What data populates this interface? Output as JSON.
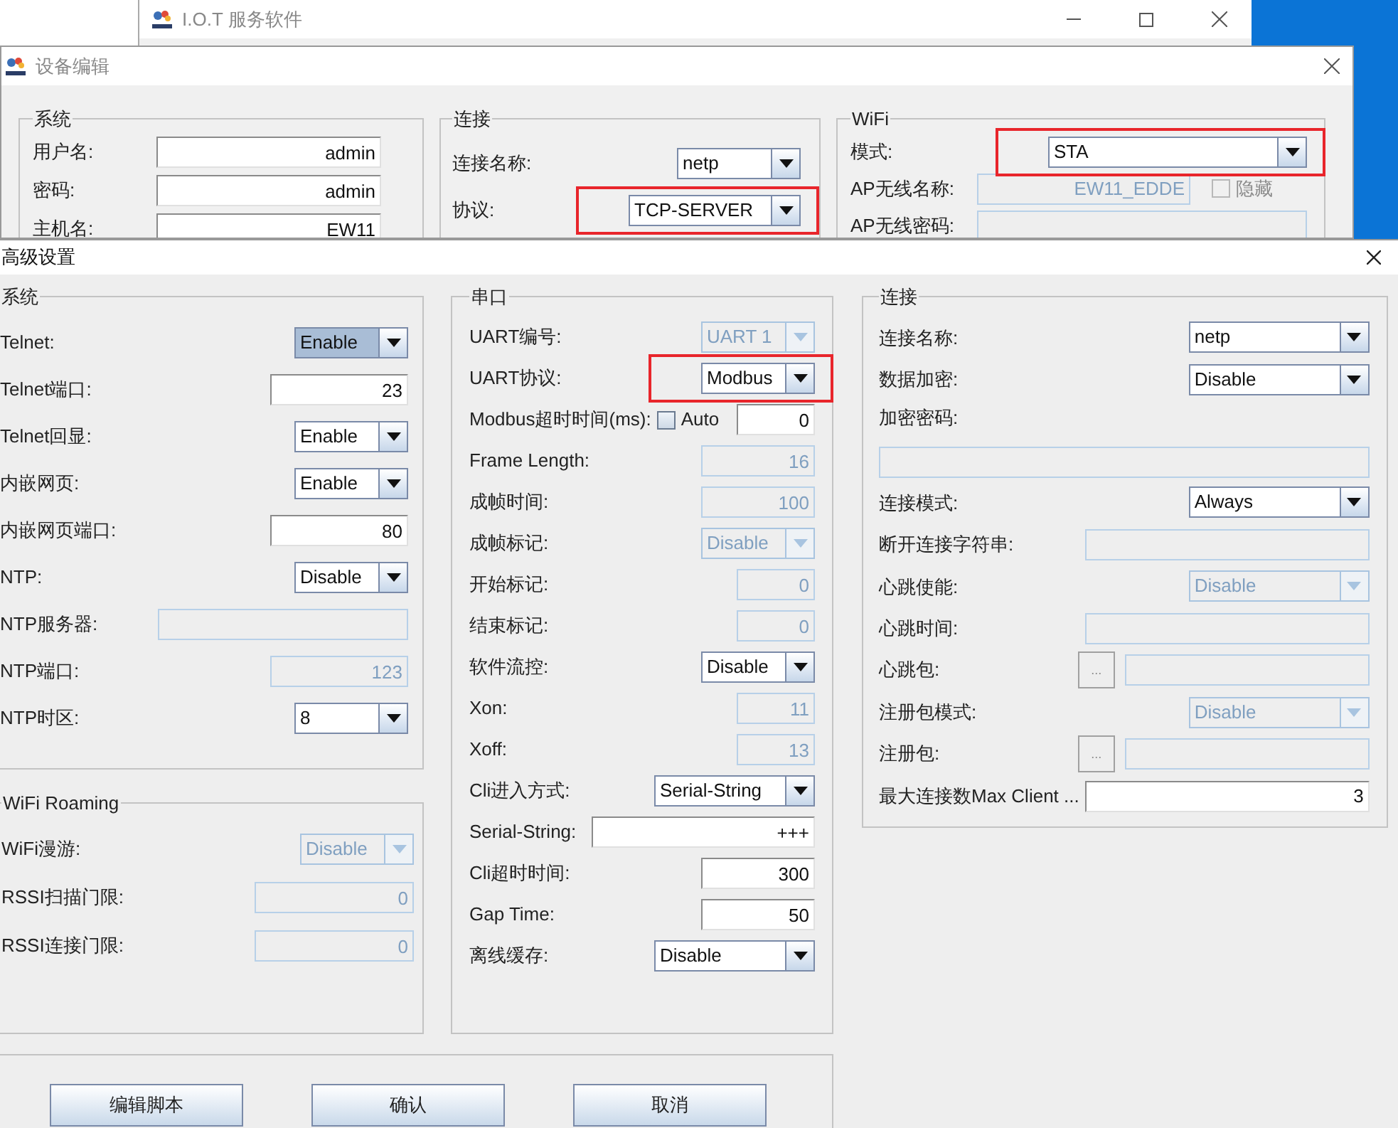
{
  "desktop_window": {
    "title": "I.O.T 服务软件"
  },
  "device_edit": {
    "title": "设备编辑",
    "groups": [
      {
        "title": "系统",
        "rows": [
          {
            "label": "用户名:",
            "kind": "field",
            "value": "admin",
            "disabled": false
          },
          {
            "label": "密码:",
            "kind": "field",
            "value": "admin",
            "disabled": false
          },
          {
            "label": "主机名:",
            "kind": "field",
            "value": "EW11",
            "disabled": false
          }
        ]
      },
      {
        "title": "连接",
        "rows": [
          {
            "label": "连接名称:",
            "kind": "combo",
            "value": "netp",
            "disabled": false,
            "highlighted": false,
            "focused": false
          },
          {
            "label": "协议:",
            "kind": "combo",
            "value": "TCP-SERVER",
            "disabled": false,
            "highlighted": true,
            "focused": false
          }
        ]
      },
      {
        "title": "WiFi",
        "rows": [
          {
            "label": "模式:",
            "kind": "combo",
            "value": "STA",
            "disabled": false,
            "highlighted": true,
            "focused": false
          },
          {
            "label": "AP无线名称:",
            "kind": "check_after",
            "value": "EW11_EDDE",
            "disabled": true,
            "check": {
              "label": "隐藏",
              "checked": false,
              "disabled": true
            }
          },
          {
            "label": "AP无线密码:",
            "kind": "field",
            "disabled": true
          }
        ]
      }
    ]
  },
  "advanced": {
    "title": "高级设置",
    "groups": [
      {
        "title": "系统",
        "rows": [
          {
            "label": "Telnet:",
            "kind": "combo",
            "value": "Enable",
            "disabled": false,
            "highlighted": false,
            "focused": true
          },
          {
            "label": "Telnet端口:",
            "kind": "field",
            "value": "23",
            "disabled": false
          },
          {
            "label": "Telnet回显:",
            "kind": "combo",
            "value": "Enable",
            "disabled": false,
            "highlighted": false,
            "focused": false
          },
          {
            "label": "内嵌网页:",
            "kind": "combo",
            "value": "Enable",
            "disabled": false,
            "highlighted": false,
            "focused": false
          },
          {
            "label": "内嵌网页端口:",
            "kind": "field",
            "value": "80",
            "disabled": false
          },
          {
            "label": "NTP:",
            "kind": "combo",
            "value": "Disable",
            "disabled": false,
            "highlighted": false,
            "focused": false
          },
          {
            "label": "NTP服务器:",
            "kind": "field",
            "disabled": true
          },
          {
            "label": "NTP端口:",
            "kind": "field",
            "value": "123",
            "disabled": true
          },
          {
            "label": "NTP时区:",
            "kind": "combo",
            "value": "8",
            "disabled": false,
            "highlighted": false,
            "focused": false
          }
        ]
      },
      {
        "title": "WiFi Roaming",
        "rows": [
          {
            "label": "WiFi漫游:",
            "kind": "combo",
            "value": "Disable",
            "disabled": true,
            "highlighted": false,
            "focused": false
          },
          {
            "label": "RSSI扫描门限:",
            "kind": "field",
            "value": "0",
            "disabled": true
          },
          {
            "label": "RSSI连接门限:",
            "kind": "field",
            "value": "0",
            "disabled": true
          }
        ]
      },
      {
        "title": "串口",
        "rows": [
          {
            "label": "UART编号:",
            "kind": "combo",
            "value": "UART 1",
            "disabled": true,
            "highlighted": false,
            "focused": false
          },
          {
            "label": "UART协议:",
            "kind": "combo",
            "value": "Modbus",
            "disabled": false,
            "highlighted": true,
            "focused": false
          },
          {
            "label": "Modbus超时时间(ms):",
            "kind": "check_before",
            "value": "0",
            "disabled": false,
            "check": {
              "label": "Auto",
              "checked": false,
              "disabled": false
            }
          },
          {
            "label": "Frame Length:",
            "kind": "field",
            "value": "16",
            "disabled": true
          },
          {
            "label": "成帧时间:",
            "kind": "field",
            "value": "100",
            "disabled": true
          },
          {
            "label": "成帧标记:",
            "kind": "combo",
            "value": "Disable",
            "disabled": true,
            "highlighted": false,
            "focused": false
          },
          {
            "label": "开始标记:",
            "kind": "field",
            "value": "0",
            "disabled": true
          },
          {
            "label": "结束标记:",
            "kind": "field",
            "value": "0",
            "disabled": true
          },
          {
            "label": "软件流控:",
            "kind": "combo",
            "value": "Disable",
            "disabled": false,
            "highlighted": false,
            "focused": false
          },
          {
            "label": "Xon:",
            "kind": "field",
            "value": "11",
            "disabled": true
          },
          {
            "label": "Xoff:",
            "kind": "field",
            "value": "13",
            "disabled": true
          },
          {
            "label": "Cli进入方式:",
            "kind": "combo",
            "value": "Serial-String",
            "disabled": false,
            "highlighted": false,
            "focused": false
          },
          {
            "label": "Serial-String:",
            "kind": "field",
            "value": "+++",
            "disabled": false
          },
          {
            "label": "Cli超时时间:",
            "kind": "field",
            "value": "300",
            "disabled": false
          },
          {
            "label": "Gap Time:",
            "kind": "field",
            "value": "50",
            "disabled": false
          },
          {
            "label": "离线缓存:",
            "kind": "combo",
            "value": "Disable",
            "disabled": false,
            "highlighted": false,
            "focused": false
          }
        ]
      },
      {
        "title": "连接",
        "rows": [
          {
            "label": "连接名称:",
            "kind": "combo",
            "value": "netp",
            "disabled": false,
            "highlighted": false,
            "focused": false
          },
          {
            "label": "数据加密:",
            "kind": "combo",
            "value": "Disable",
            "disabled": false,
            "highlighted": false,
            "focused": false
          },
          {
            "label": "加密密码:",
            "kind": "field_below",
            "disabled": true
          },
          {
            "label": "连接模式:",
            "kind": "combo",
            "value": "Always",
            "disabled": false,
            "highlighted": false,
            "focused": false
          },
          {
            "label": "断开连接字符串:",
            "kind": "field",
            "disabled": true
          },
          {
            "label": "心跳使能:",
            "kind": "combo",
            "value": "Disable",
            "disabled": true,
            "highlighted": false,
            "focused": false
          },
          {
            "label": "心跳时间:",
            "kind": "field",
            "disabled": true
          },
          {
            "label": "心跳包:",
            "kind": "button_field",
            "button": "...",
            "disabled": true
          },
          {
            "label": "注册包模式:",
            "kind": "combo",
            "value": "Disable",
            "disabled": true,
            "highlighted": false,
            "focused": false
          },
          {
            "label": "注册包:",
            "kind": "button_field",
            "button": "...",
            "disabled": true
          },
          {
            "label": "最大连接数Max Client ...",
            "kind": "field",
            "value": "3",
            "disabled": false
          }
        ]
      }
    ],
    "buttons": [
      "编辑脚本",
      "确认",
      "取消"
    ]
  }
}
